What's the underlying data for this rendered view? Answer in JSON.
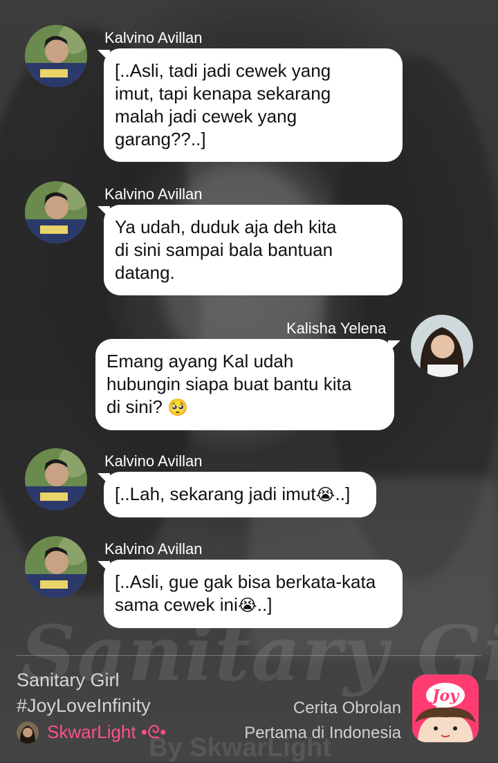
{
  "messages": [
    {
      "sender": "Kalvino Avillan",
      "text": "[..Asli, tadi jadi cewek yang\nimut, tapi kenapa sekarang\nmalah jadi cewek yang\ngarang??..]",
      "emoji": ""
    },
    {
      "sender": "Kalvino Avillan",
      "text": "Ya udah, duduk aja deh kita\ndi sini sampai bala bantuan\ndatang.",
      "emoji": ""
    },
    {
      "sender": "Kalisha Yelena",
      "text": "Emang ayang Kal udah\nhubungin siapa buat bantu kita\ndi sini?",
      "emoji": "🥺"
    },
    {
      "sender": "Kalvino Avillan",
      "text": "[..Lah, sekarang jadi imut",
      "emoji": "😭",
      "suffix": "..]"
    },
    {
      "sender": "Kalvino Avillan",
      "text": "[..Asli, gue gak bisa berkata-kata\nsama cewek ini",
      "emoji": "😭",
      "suffix": "..]"
    }
  ],
  "footer": {
    "story_title": "Sanitary Girl",
    "hashtag": "#JoyLoveInfinity",
    "author": "SkwarLight •ᘓ•",
    "promo_line1": "Cerita Obrolan",
    "promo_line2": "Pertama di Indonesia",
    "logo_text": "Joy"
  },
  "background": {
    "watermark_title": "Sanitary Girl",
    "watermark_byline": "By SkwarLight"
  },
  "colors": {
    "bubble": "#ffffff",
    "author": "#ff4f8b",
    "logo": "#ff3c72"
  }
}
